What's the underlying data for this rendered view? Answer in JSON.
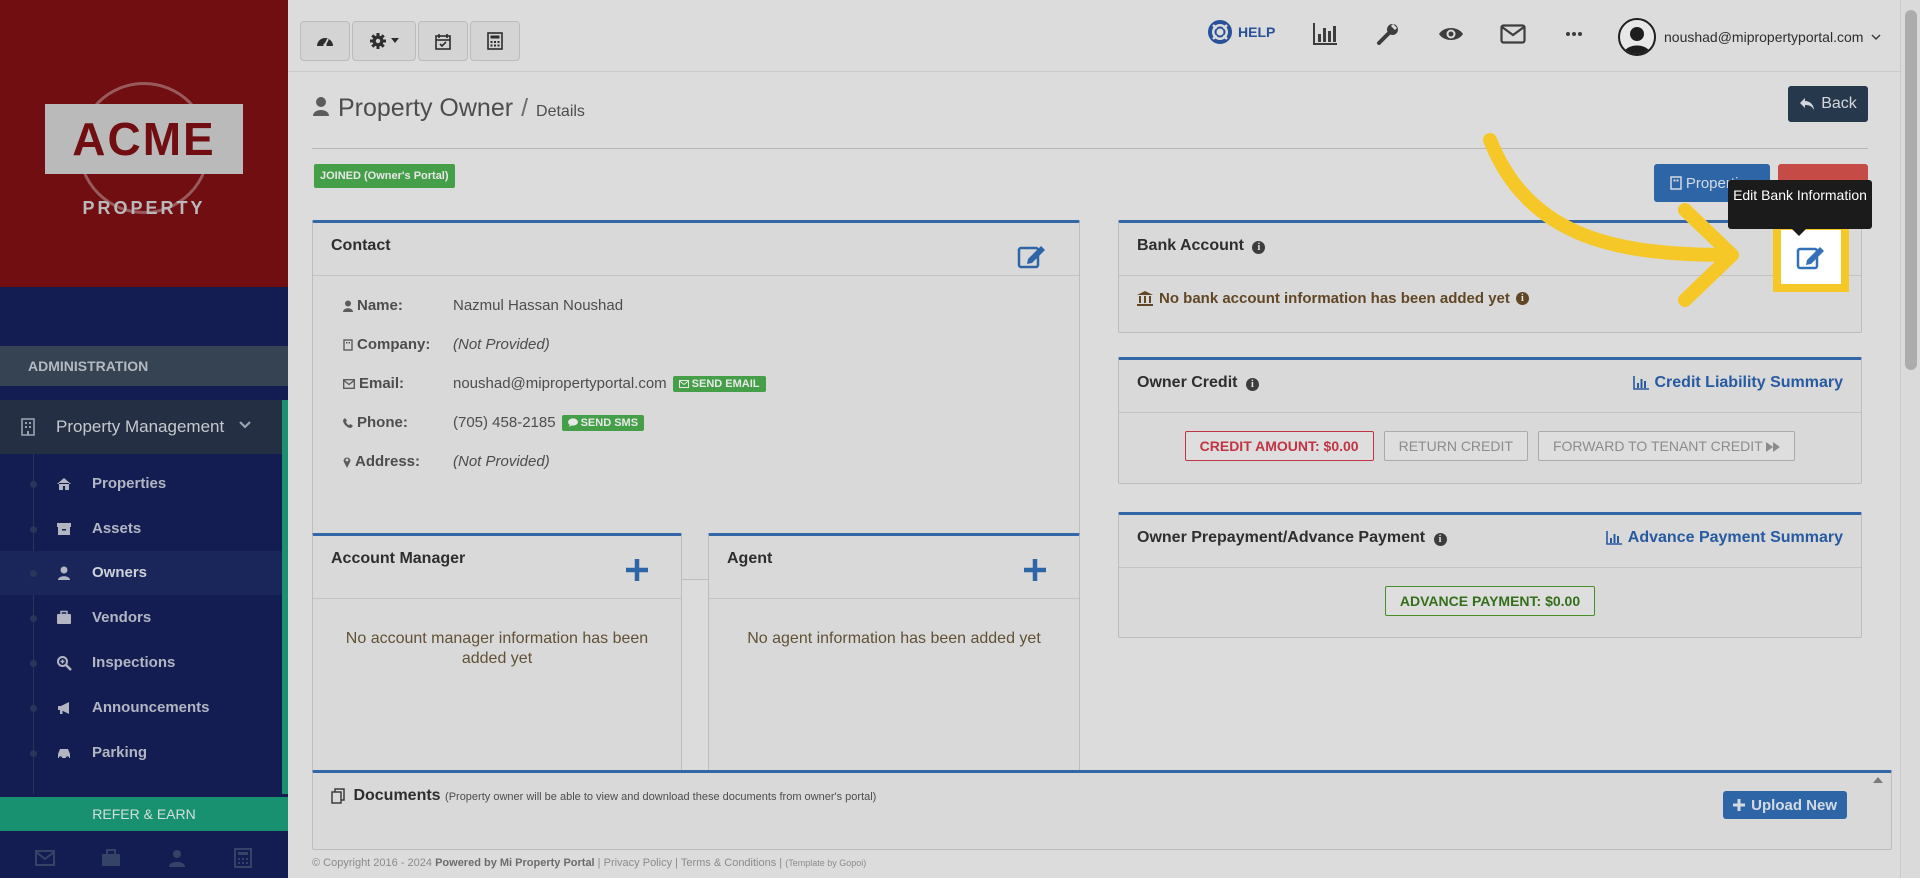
{
  "sidebar": {
    "logo_text": "ACME",
    "logo_sub": "PROPERTY",
    "section_label": "ADMINISTRATION",
    "group_label": "Property Management",
    "items": [
      {
        "label": "Properties",
        "icon": "home-icon"
      },
      {
        "label": "Assets",
        "icon": "archive-icon"
      },
      {
        "label": "Owners",
        "icon": "user-icon",
        "active": true
      },
      {
        "label": "Vendors",
        "icon": "briefcase-icon"
      },
      {
        "label": "Inspections",
        "icon": "search-plus-icon"
      },
      {
        "label": "Announcements",
        "icon": "bullhorn-icon"
      },
      {
        "label": "Parking",
        "icon": "car-icon"
      }
    ],
    "refer_label": "REFER & EARN",
    "bottom_icons": [
      "envelope-icon",
      "briefcase-icon",
      "user-icon",
      "calculator-icon"
    ]
  },
  "topbar": {
    "buttons": [
      "dashboard-icon",
      "gear-icon",
      "calendar-check-icon",
      "calculator-icon"
    ],
    "help_label": "HELP",
    "user_email": "noushad@mipropertyportal.com"
  },
  "page": {
    "title": "Property Owner",
    "separator": "/",
    "subtitle": "Details",
    "back_label": "Back",
    "joined_badge": "JOINED (Owner's Portal)",
    "properties_label": "Properties"
  },
  "contact": {
    "title": "Contact",
    "rows": [
      {
        "key": "Name:",
        "value": "Nazmul Hassan Noushad",
        "italic": false
      },
      {
        "key": "Company:",
        "value": "(Not Provided)",
        "italic": true
      },
      {
        "key": "Email:",
        "value": "noushad@mipropertyportal.com",
        "italic": false,
        "badge": "SEND EMAIL"
      },
      {
        "key": "Phone:",
        "value": "(705) 458-2185",
        "italic": false,
        "badge": "SEND SMS"
      },
      {
        "key": "Address:",
        "value": "(Not Provided)",
        "italic": true
      }
    ]
  },
  "account_manager": {
    "title": "Account Manager",
    "empty": "No account manager information has been added yet"
  },
  "agent": {
    "title": "Agent",
    "empty": "No agent information has been added yet"
  },
  "bank": {
    "title": "Bank Account",
    "empty": "No bank account information has been added yet",
    "tooltip": "Edit Bank Information"
  },
  "owner_credit": {
    "title": "Owner Credit",
    "link": "Credit Liability Summary",
    "credit_amount": "CREDIT AMOUNT: $0.00",
    "return_credit": "RETURN CREDIT",
    "forward_credit": "FORWARD TO TENANT CREDIT"
  },
  "prepayment": {
    "title": "Owner Prepayment/Advance Payment",
    "link": "Advance Payment Summary",
    "amount": "ADVANCE PAYMENT: $0.00"
  },
  "documents": {
    "title": "Documents",
    "note": "(Property owner will be able to view and download these documents from owner's portal)",
    "upload_label": "Upload New"
  },
  "footer": {
    "copyright": "© Copyright 2016 - 2024",
    "powered": "Powered by Mi Property Portal",
    "privacy": "Privacy Policy",
    "terms": "Terms & Conditions",
    "template": "(Template by Gopoi)"
  },
  "colors": {
    "accent_blue": "#3370b8",
    "sidebar_navy": "#15205a",
    "logo_red": "#7c1014",
    "green": "#1aa07b",
    "highlight_yellow": "#f6c827"
  }
}
